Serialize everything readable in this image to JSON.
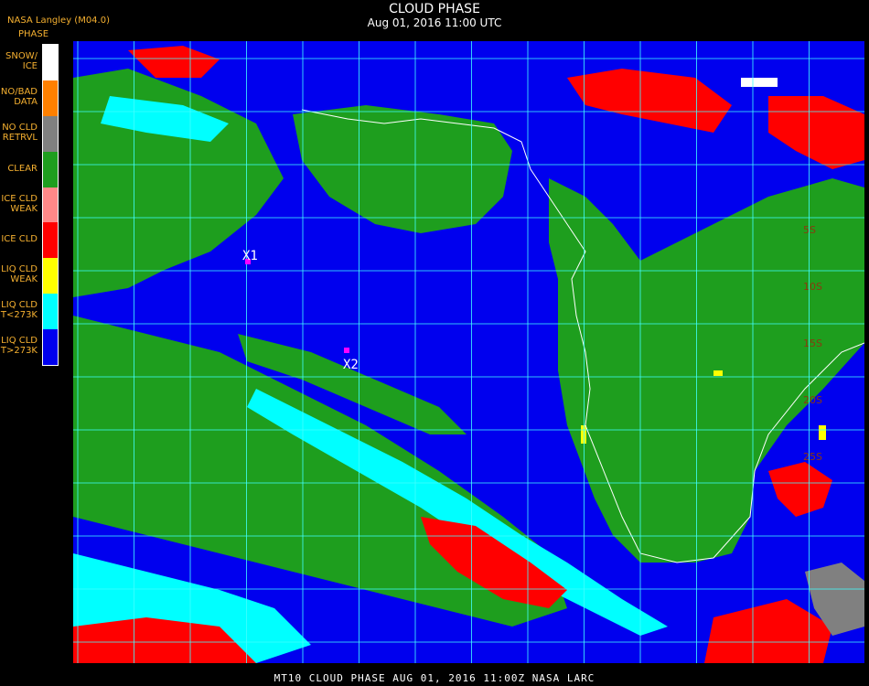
{
  "header": {
    "title": "CLOUD PHASE",
    "subtitle": "Aug 01, 2016 11:00 UTC",
    "source": "NASA Langley (M04.0)"
  },
  "legend": {
    "title": "PHASE",
    "items": [
      {
        "label": "SNOW/\nICE",
        "color": "#ffffff"
      },
      {
        "label": "NO/BAD\nDATA",
        "color": "#ff8000"
      },
      {
        "label": "NO CLD\nRETRVL",
        "color": "#808080"
      },
      {
        "label": "CLEAR",
        "color": "#1e9e1e"
      },
      {
        "label": "ICE CLD\nWEAK",
        "color": "#ff8888"
      },
      {
        "label": "ICE CLD",
        "color": "#ff0000"
      },
      {
        "label": "LIQ CLD\nWEAK",
        "color": "#ffff00"
      },
      {
        "label": "LIQ CLD\nT<273K",
        "color": "#00ffff"
      },
      {
        "label": "LIQ CLD\nT>273K",
        "color": "#0000ee"
      }
    ]
  },
  "map": {
    "markers": [
      {
        "label": "X1",
        "color": "#ff00ff"
      },
      {
        "label": "X2",
        "color": "#ff00ff"
      }
    ],
    "latitude_labels": [
      "5S",
      "10S",
      "15S",
      "20S",
      "25S"
    ]
  },
  "footer": "MT10   CLOUD PHASE    AUG 01, 2016 11:00Z   NASA LARC"
}
